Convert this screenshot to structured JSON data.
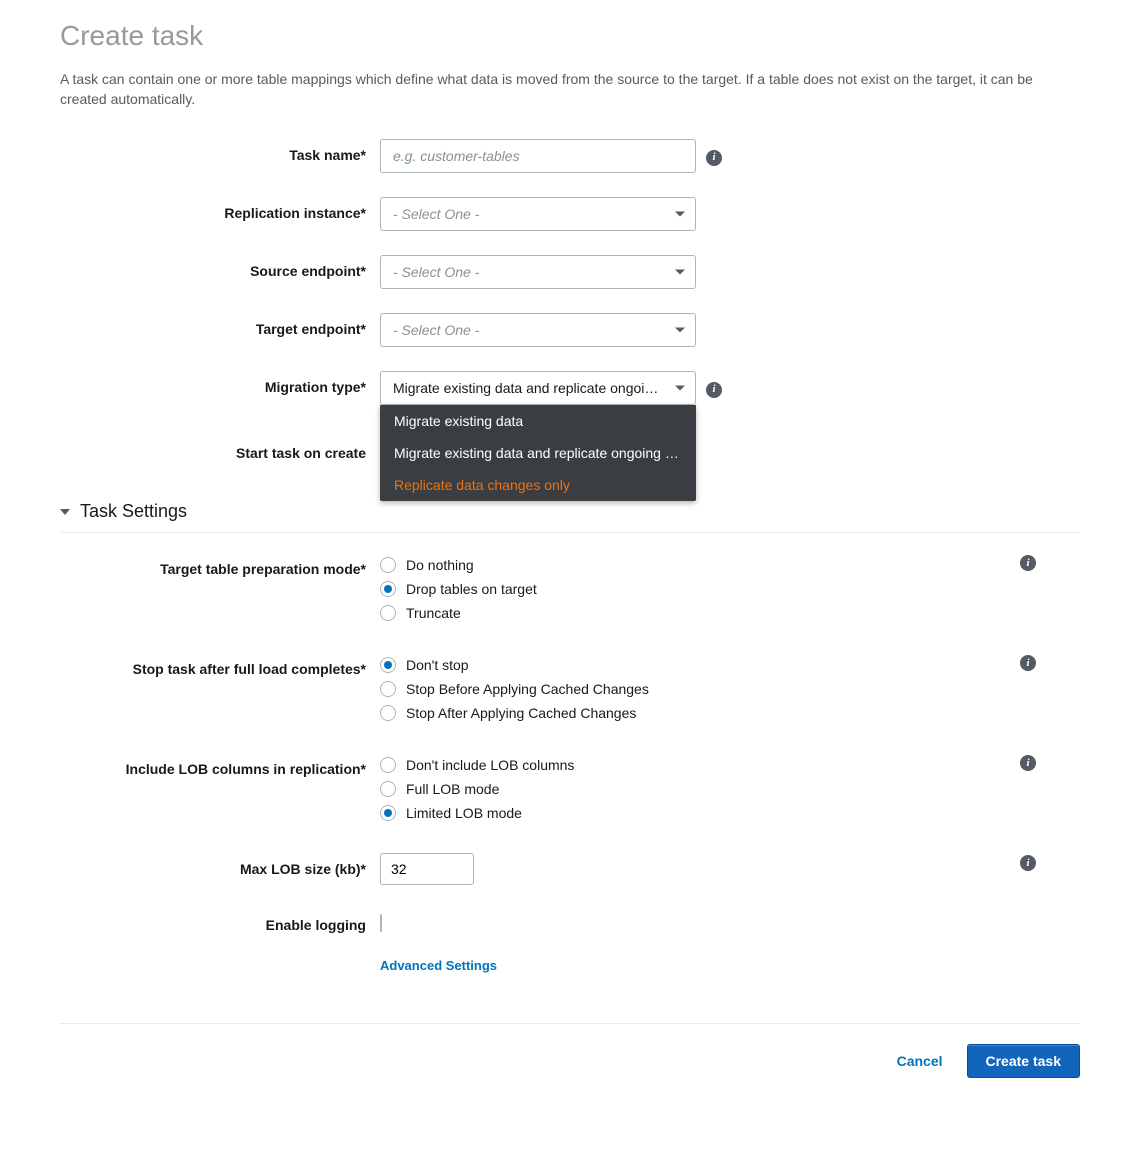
{
  "page": {
    "title": "Create task",
    "intro": "A task can contain one or more table mappings which define what data is moved from the source to the target. If a table does not exist on the target, it can be created automatically."
  },
  "form": {
    "task_name": {
      "label": "Task name*",
      "placeholder": "e.g. customer-tables",
      "value": ""
    },
    "replication_instance": {
      "label": "Replication instance*",
      "placeholder": "- Select One -"
    },
    "source_endpoint": {
      "label": "Source endpoint*",
      "placeholder": "- Select One -"
    },
    "target_endpoint": {
      "label": "Target endpoint*",
      "placeholder": "- Select One -"
    },
    "migration_type": {
      "label": "Migration type*",
      "selected": "Migrate existing data and replicate ongoing …",
      "options": [
        "Migrate existing data",
        "Migrate existing data and replicate ongoing ch…",
        "Replicate data changes only"
      ],
      "active_index": 2
    },
    "start_on_create": {
      "label": "Start task on create"
    }
  },
  "section": {
    "title": "Task Settings"
  },
  "settings": {
    "target_prep": {
      "label": "Target table preparation mode*",
      "options": [
        "Do nothing",
        "Drop tables on target",
        "Truncate"
      ],
      "selected_index": 1
    },
    "stop_after_load": {
      "label": "Stop task after full load completes*",
      "options": [
        "Don't stop",
        "Stop Before Applying Cached Changes",
        "Stop After Applying Cached Changes"
      ],
      "selected_index": 0
    },
    "lob_columns": {
      "label": "Include LOB columns in replication*",
      "options": [
        "Don't include LOB columns",
        "Full LOB mode",
        "Limited LOB mode"
      ],
      "selected_index": 2
    },
    "max_lob": {
      "label": "Max LOB size (kb)*",
      "value": "32"
    },
    "enable_logging": {
      "label": "Enable logging"
    },
    "advanced_link": "Advanced Settings"
  },
  "footer": {
    "cancel": "Cancel",
    "create": "Create task"
  }
}
